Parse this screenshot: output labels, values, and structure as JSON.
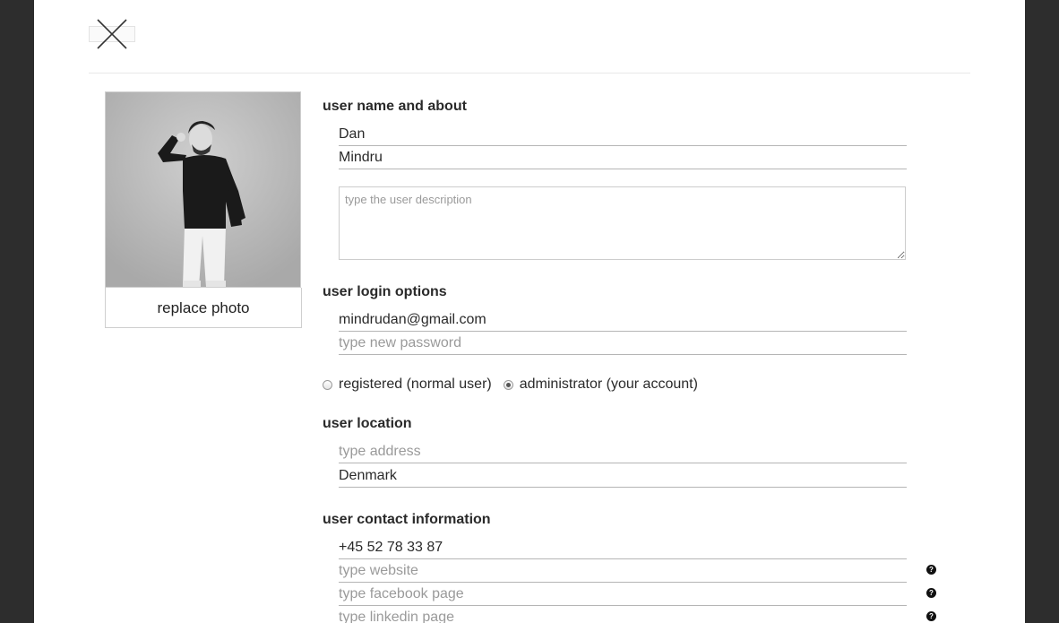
{
  "close": {
    "icon": "close-x-icon"
  },
  "photo": {
    "replace_label": "replace photo"
  },
  "sections": {
    "name_about": "user name and about",
    "login": "user login options",
    "location": "user location",
    "contact": "user contact information"
  },
  "fields": {
    "first_name": {
      "value": "Dan",
      "placeholder": ""
    },
    "last_name": {
      "value": "Mindru",
      "placeholder": ""
    },
    "description": {
      "value": "",
      "placeholder": "type the user description"
    },
    "email": {
      "value": "mindrudan@gmail.com",
      "placeholder": ""
    },
    "password": {
      "value": "",
      "placeholder": "type new password"
    },
    "address": {
      "value": "",
      "placeholder": "type address"
    },
    "country": {
      "value": "Denmark",
      "placeholder": ""
    },
    "phone": {
      "value": "+45 52 78 33 87",
      "placeholder": ""
    },
    "website": {
      "value": "",
      "placeholder": "type website"
    },
    "facebook": {
      "value": "",
      "placeholder": "type facebook page"
    },
    "linkedin": {
      "value": "",
      "placeholder": "type linkedin page"
    }
  },
  "roles": [
    {
      "label": "registered (normal user)",
      "checked": false
    },
    {
      "label": "administrator (your account)",
      "checked": true
    }
  ],
  "help_icon": "help-question-icon",
  "help_glyph": "?"
}
